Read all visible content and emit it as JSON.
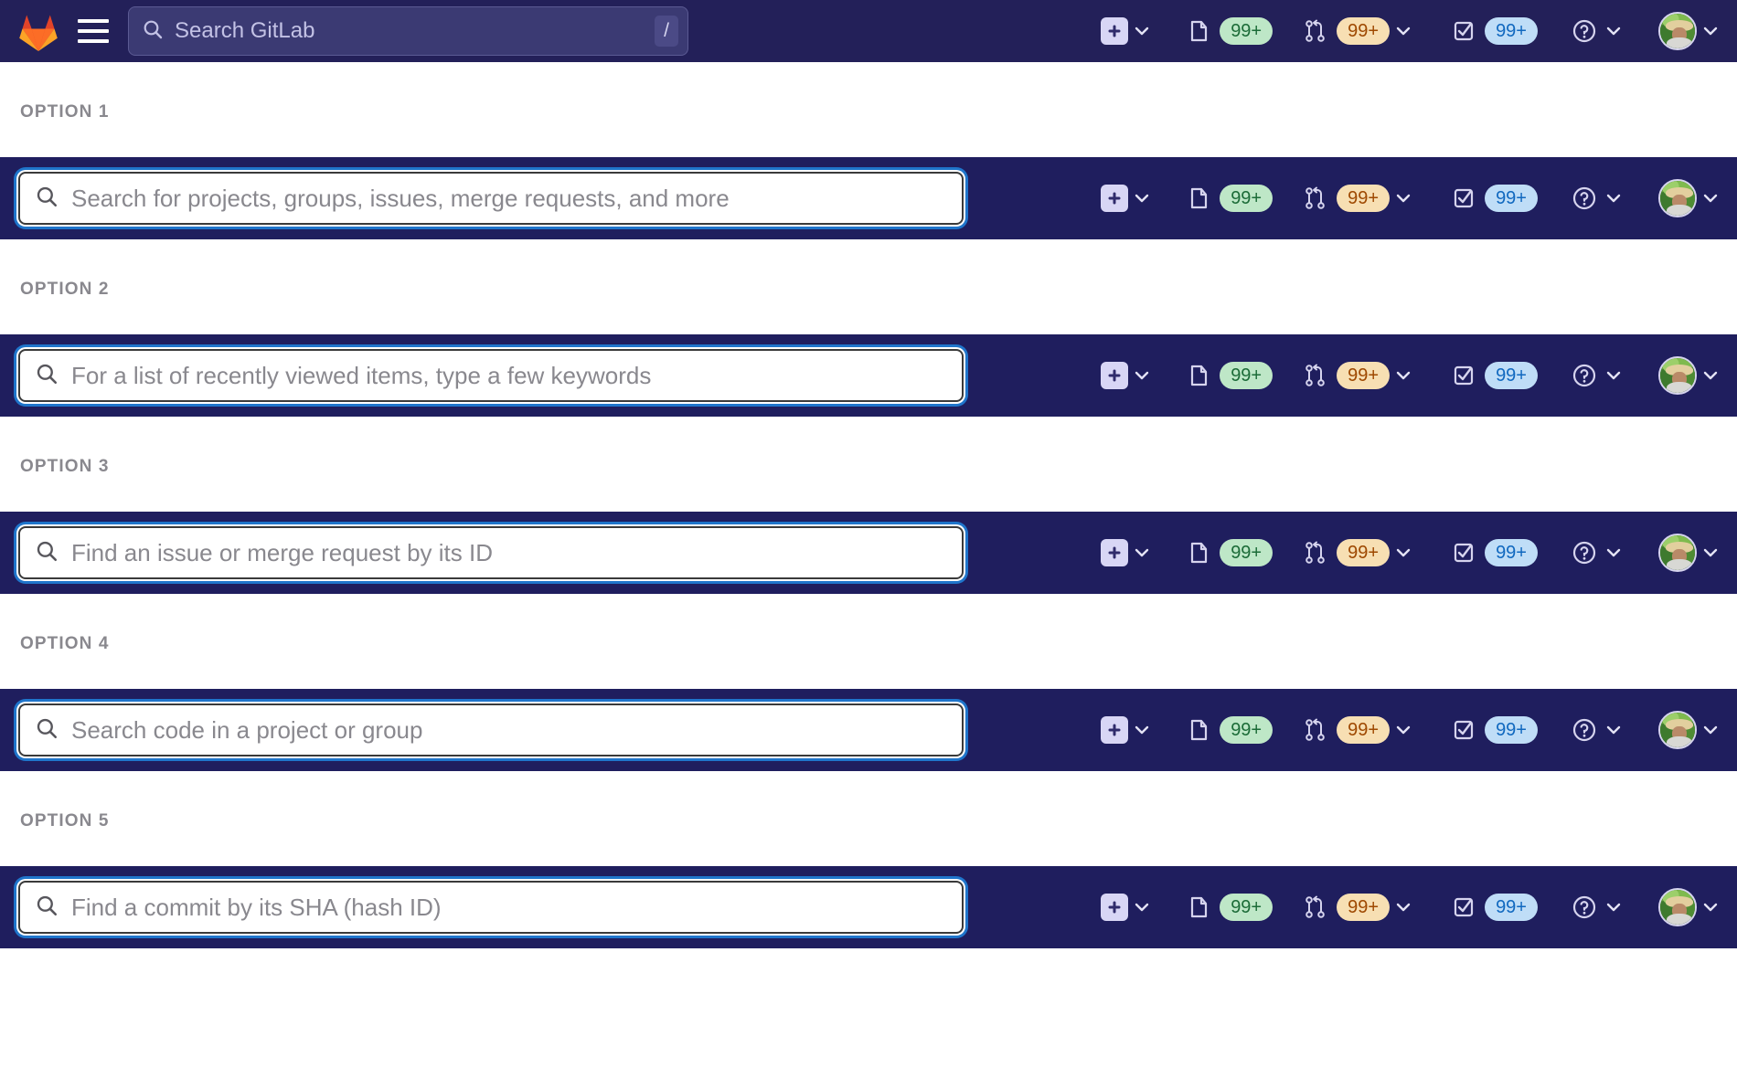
{
  "app": {
    "name": "GitLab",
    "logo_icon": "gitlab-logo-icon",
    "menu_icon": "hamburger-menu-icon",
    "navy_color": "#201F60",
    "focus_ring_color": "#1F75CB"
  },
  "top_navbar": {
    "search": {
      "icon": "search-icon",
      "placeholder": "Search GitLab",
      "value": "",
      "shortcut_key": "/"
    }
  },
  "actions": {
    "create_new": {
      "icon": "plus-icon",
      "label": "Create new...",
      "chevron": "chevron-down-icon"
    },
    "issues": {
      "icon": "issues-icon",
      "badge": "99+",
      "badge_color": "#BEE7C7",
      "badge_text_color": "#1B6B37"
    },
    "merge_requests": {
      "icon": "merge-request-icon",
      "badge": "99+",
      "badge_color": "#F7DFB3",
      "badge_text_color": "#9E4800",
      "chevron": "chevron-down-icon"
    },
    "todos": {
      "icon": "todo-checkbox-icon",
      "badge": "99+",
      "badge_color": "#BFDDF7",
      "badge_text_color": "#1068BF"
    },
    "help": {
      "icon": "help-question-icon",
      "chevron": "chevron-down-icon"
    },
    "user": {
      "icon": "user-avatar",
      "chevron": "chevron-down-icon"
    }
  },
  "options": [
    {
      "label": "OPTION 1",
      "search_placeholder": "Search for projects, groups, issues, merge requests, and more",
      "value": ""
    },
    {
      "label": "OPTION 2",
      "search_placeholder": "For a list of recently viewed items, type a few keywords",
      "value": ""
    },
    {
      "label": "OPTION 3",
      "search_placeholder": "Find an issue or merge request by its ID",
      "value": ""
    },
    {
      "label": "OPTION 4",
      "search_placeholder": "Search code in a project or group",
      "value": ""
    },
    {
      "label": "OPTION 5",
      "search_placeholder": "Find a commit by its SHA (hash ID)",
      "value": ""
    }
  ]
}
